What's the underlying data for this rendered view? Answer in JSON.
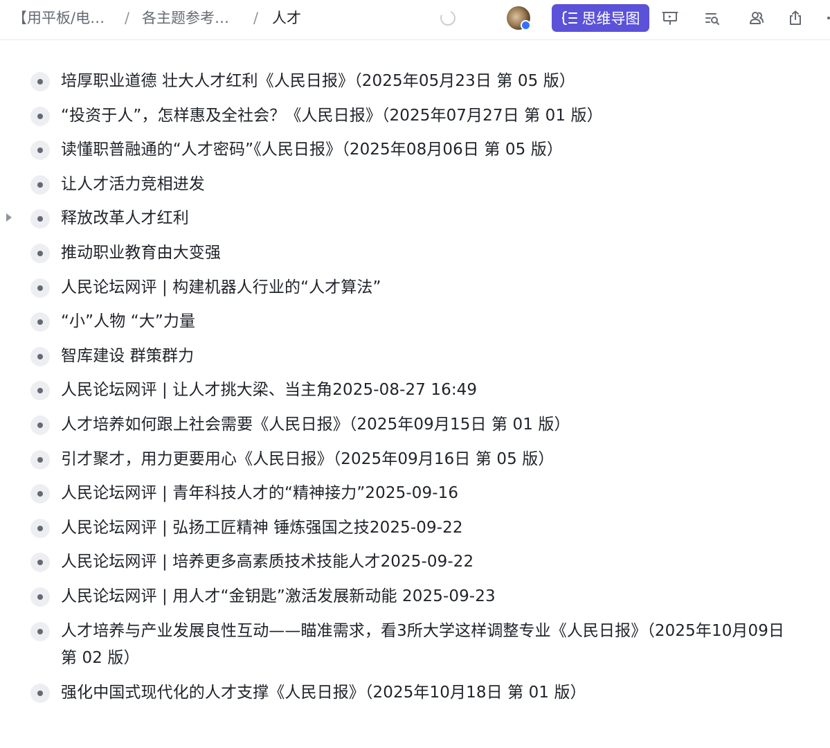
{
  "breadcrumb": {
    "items": [
      "【用平板/电…",
      "各主题参考…"
    ],
    "current": "人才",
    "separator": "/"
  },
  "toolbar": {
    "mindmap_label": "思维导图",
    "accent_color": "#5b52d9",
    "icons": [
      "loading-spinner-icon",
      "user-avatar",
      "mindmap-icon",
      "presentation-icon",
      "search-in-doc-icon",
      "collaborate-icon",
      "share-export-icon"
    ]
  },
  "outline": {
    "items": [
      {
        "text": "培厚职业道德 壮大人才红利《人民日报》（2025年05月23日 第 05 版）"
      },
      {
        "text": "“投资于人”，怎样惠及全社会？《人民日报》（2025年07月27日 第 01 版）"
      },
      {
        "text": "读懂职普融通的“人才密码”《人民日报》（2025年08月06日 第 05 版）"
      },
      {
        "text": "让人才活力竞相进发"
      },
      {
        "text": "释放改革人才红利",
        "collapsed": true
      },
      {
        "text": "推动职业教育由大变强"
      },
      {
        "text": "人民论坛网评 | 构建机器人行业的“人才算法”"
      },
      {
        "text": "“小”人物 “大”力量"
      },
      {
        "text": "智库建设 群策群力"
      },
      {
        "text": "人民论坛网评 | 让人才挑大梁、当主角2025-08-27 16:49"
      },
      {
        "text": "人才培养如何跟上社会需要《人民日报》（2025年09月15日 第 01 版）"
      },
      {
        "text": "引才聚才，用力更要用心《人民日报》（2025年09月16日 第 05 版）"
      },
      {
        "text": "人民论坛网评 | 青年科技人才的“精神接力”2025-09-16"
      },
      {
        "text": "人民论坛网评 | 弘扬工匠精神 锤炼强国之技2025-09-22"
      },
      {
        "text": "人民论坛网评 | 培养更多高素质技术技能人才2025-09-22"
      },
      {
        "text": "人民论坛网评 | 用人才“金钥匙”激活发展新动能 2025-09-23"
      },
      {
        "text": "人才培养与产业发展良性互动——瞄准需求，看3所大学这样调整专业《人民日报》（2025年10月09日 第 02 版）",
        "wrap": true
      },
      {
        "text": "强化中国式现代化的人才支撑《人民日报》（2025年10月18日 第 01 版）"
      }
    ]
  }
}
